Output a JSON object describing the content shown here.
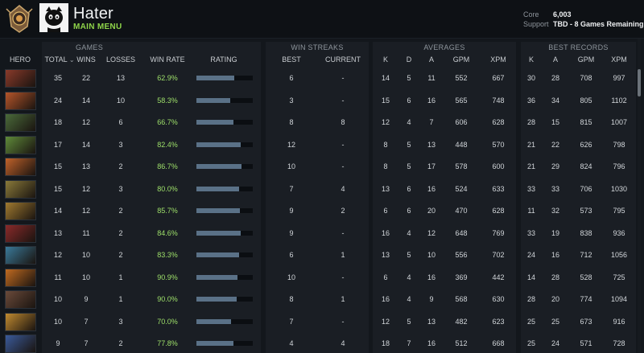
{
  "header": {
    "player_name": "Hater",
    "main_menu_label": "MAIN MENU",
    "mmr": [
      {
        "label": "Core",
        "value": "6,003"
      },
      {
        "label": "Support",
        "value": "TBD - 8 Games Remaining"
      }
    ]
  },
  "columns": {
    "groups": {
      "games": "GAMES",
      "win_streaks": "WIN STREAKS",
      "averages": "AVERAGES",
      "best_records": "BEST RECORDS"
    },
    "hero": "HERO",
    "total": "TOTAL",
    "total_sort": "⌄",
    "wins": "WINS",
    "losses": "LOSSES",
    "win_rate": "WIN RATE",
    "rating": "RATING",
    "best": "BEST",
    "current": "CURRENT",
    "k": "K",
    "d": "D",
    "a": "A",
    "gpm": "GPM",
    "xpm": "XPM",
    "rec_k": "K",
    "rec_a": "A",
    "rec_gpm": "GPM",
    "rec_xpm": "XPM"
  },
  "rows": [
    {
      "portrait_color": "#8a3a2a",
      "total": "35",
      "wins": "22",
      "losses": "13",
      "win_rate": "62.9%",
      "rating": 0.67,
      "best": "6",
      "current": "-",
      "k": "14",
      "d": "5",
      "a": "11",
      "gpm": "552",
      "xpm": "667",
      "rk": "30",
      "ra": "28",
      "rgpm": "708",
      "rxpm": "997"
    },
    {
      "portrait_color": "#b5552a",
      "total": "24",
      "wins": "14",
      "losses": "10",
      "win_rate": "58.3%",
      "rating": 0.6,
      "best": "3",
      "current": "-",
      "k": "15",
      "d": "6",
      "a": "16",
      "gpm": "565",
      "xpm": "748",
      "rk": "36",
      "ra": "34",
      "rgpm": "805",
      "rxpm": "1102"
    },
    {
      "portrait_color": "#4a6a3a",
      "total": "18",
      "wins": "12",
      "losses": "6",
      "win_rate": "66.7%",
      "rating": 0.66,
      "best": "8",
      "current": "8",
      "k": "12",
      "d": "4",
      "a": "7",
      "gpm": "606",
      "xpm": "628",
      "rk": "28",
      "ra": "15",
      "rgpm": "815",
      "rxpm": "1007"
    },
    {
      "portrait_color": "#5f8a3a",
      "total": "17",
      "wins": "14",
      "losses": "3",
      "win_rate": "82.4%",
      "rating": 0.79,
      "best": "12",
      "current": "-",
      "k": "8",
      "d": "5",
      "a": "13",
      "gpm": "448",
      "xpm": "570",
      "rk": "21",
      "ra": "22",
      "rgpm": "626",
      "rxpm": "798"
    },
    {
      "portrait_color": "#c0622a",
      "total": "15",
      "wins": "13",
      "losses": "2",
      "win_rate": "86.7%",
      "rating": 0.8,
      "best": "10",
      "current": "-",
      "k": "8",
      "d": "5",
      "a": "17",
      "gpm": "578",
      "xpm": "600",
      "rk": "21",
      "ra": "29",
      "rgpm": "824",
      "rxpm": "796"
    },
    {
      "portrait_color": "#8a7a3a",
      "total": "15",
      "wins": "12",
      "losses": "3",
      "win_rate": "80.0%",
      "rating": 0.76,
      "best": "7",
      "current": "4",
      "k": "13",
      "d": "6",
      "a": "16",
      "gpm": "524",
      "xpm": "633",
      "rk": "33",
      "ra": "33",
      "rgpm": "706",
      "rxpm": "1030"
    },
    {
      "portrait_color": "#a07a30",
      "total": "14",
      "wins": "12",
      "losses": "2",
      "win_rate": "85.7%",
      "rating": 0.77,
      "best": "9",
      "current": "2",
      "k": "6",
      "d": "6",
      "a": "20",
      "gpm": "470",
      "xpm": "628",
      "rk": "11",
      "ra": "32",
      "rgpm": "573",
      "rxpm": "795"
    },
    {
      "portrait_color": "#8a2a2a",
      "total": "13",
      "wins": "11",
      "losses": "2",
      "win_rate": "84.6%",
      "rating": 0.78,
      "best": "9",
      "current": "-",
      "k": "16",
      "d": "4",
      "a": "12",
      "gpm": "648",
      "xpm": "769",
      "rk": "33",
      "ra": "19",
      "rgpm": "838",
      "rxpm": "936"
    },
    {
      "portrait_color": "#3a7a9a",
      "total": "12",
      "wins": "10",
      "losses": "2",
      "win_rate": "83.3%",
      "rating": 0.76,
      "best": "6",
      "current": "1",
      "k": "13",
      "d": "5",
      "a": "10",
      "gpm": "556",
      "xpm": "702",
      "rk": "24",
      "ra": "16",
      "rgpm": "712",
      "rxpm": "1056"
    },
    {
      "portrait_color": "#c06a20",
      "total": "11",
      "wins": "10",
      "losses": "1",
      "win_rate": "90.9%",
      "rating": 0.73,
      "best": "10",
      "current": "-",
      "k": "6",
      "d": "4",
      "a": "16",
      "gpm": "369",
      "xpm": "442",
      "rk": "14",
      "ra": "28",
      "rgpm": "528",
      "rxpm": "725"
    },
    {
      "portrait_color": "#6a4a3a",
      "total": "10",
      "wins": "9",
      "losses": "1",
      "win_rate": "90.0%",
      "rating": 0.72,
      "best": "8",
      "current": "1",
      "k": "16",
      "d": "4",
      "a": "9",
      "gpm": "568",
      "xpm": "630",
      "rk": "28",
      "ra": "20",
      "rgpm": "774",
      "rxpm": "1094"
    },
    {
      "portrait_color": "#c08a30",
      "total": "10",
      "wins": "7",
      "losses": "3",
      "win_rate": "70.0%",
      "rating": 0.62,
      "best": "7",
      "current": "-",
      "k": "12",
      "d": "5",
      "a": "13",
      "gpm": "482",
      "xpm": "623",
      "rk": "25",
      "ra": "25",
      "rgpm": "673",
      "rxpm": "916"
    },
    {
      "portrait_color": "#3a5a9a",
      "total": "9",
      "wins": "7",
      "losses": "2",
      "win_rate": "77.8%",
      "rating": 0.66,
      "best": "4",
      "current": "4",
      "k": "18",
      "d": "7",
      "a": "16",
      "gpm": "512",
      "xpm": "668",
      "rk": "25",
      "ra": "24",
      "rgpm": "571",
      "rxpm": "728"
    }
  ]
}
